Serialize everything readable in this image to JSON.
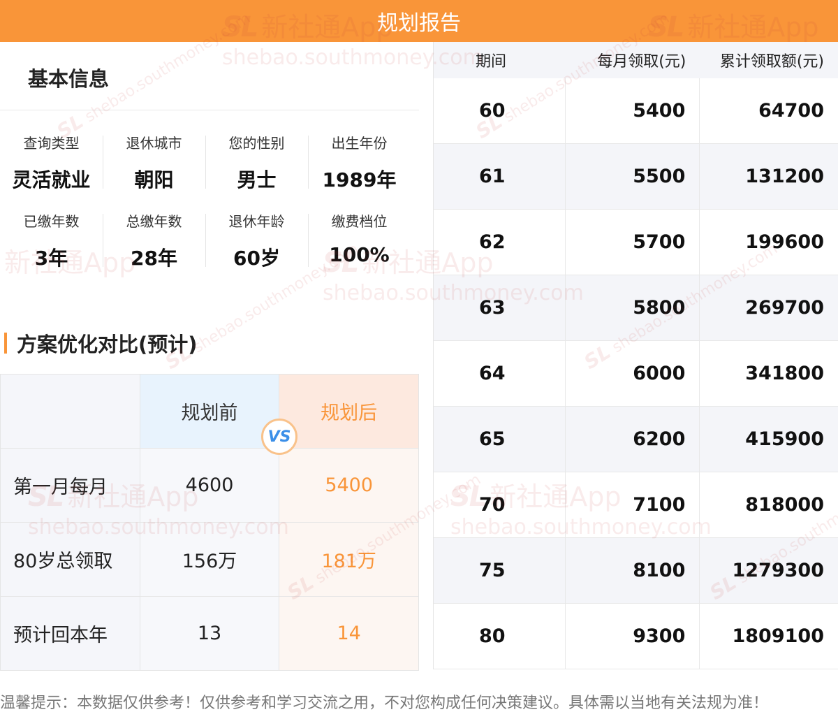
{
  "header": {
    "title": "规划报告"
  },
  "basic_info": {
    "title": "基本信息",
    "rows": [
      [
        {
          "label": "查询类型",
          "value": "灵活就业"
        },
        {
          "label": "退休城市",
          "value": "朝阳"
        },
        {
          "label": "您的性别",
          "value": "男士"
        },
        {
          "label": "出生年份",
          "value": "1989年"
        }
      ],
      [
        {
          "label": "已缴年数",
          "value": "3年"
        },
        {
          "label": "总缴年数",
          "value": "28年"
        },
        {
          "label": "退休年龄",
          "value": "60岁"
        },
        {
          "label": "缴费档位",
          "value": "100%"
        }
      ]
    ]
  },
  "comparison": {
    "title": "方案优化对比(预计)",
    "before_label": "规划前",
    "after_label": "规划后",
    "vs": "VS",
    "rows": [
      {
        "label": "第一月每月",
        "before": "4600",
        "after": "5400"
      },
      {
        "label": "80岁总领取",
        "before": "156万",
        "after": "181万"
      },
      {
        "label": "预计回本年",
        "before": "13",
        "after": "14"
      }
    ]
  },
  "payout_table": {
    "headers": [
      "期间",
      "每月领取(元)",
      "累计领取额(元)"
    ],
    "rows": [
      [
        "60",
        "5400",
        "64700"
      ],
      [
        "61",
        "5500",
        "131200"
      ],
      [
        "62",
        "5700",
        "199600"
      ],
      [
        "63",
        "5800",
        "269700"
      ],
      [
        "64",
        "6000",
        "341800"
      ],
      [
        "65",
        "6200",
        "415900"
      ],
      [
        "70",
        "7100",
        "818000"
      ],
      [
        "75",
        "8100",
        "1279300"
      ],
      [
        "80",
        "9300",
        "1809100"
      ]
    ]
  },
  "footer": {
    "text": "温馨提示：本数据仅供参考！仅供参考和学习交流之用，不对您构成任何决策建议。具体需以当地有关法规为准！"
  },
  "watermark": {
    "logo": "SL",
    "brand": "新社通App",
    "url": "shebao.southmoney.com",
    "rot_url": "shebao.southmoney.com"
  },
  "colors": {
    "accent": "#f99539",
    "before_bg": "#e8f3fd",
    "after_bg": "#fde9df",
    "vs_text": "#3b8fe8"
  }
}
